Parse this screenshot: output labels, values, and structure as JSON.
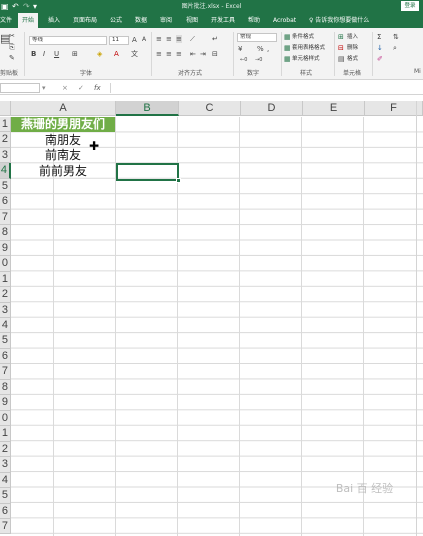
{
  "titlebar": {
    "title": "图片批注.xlsx - Excel",
    "login": "登录",
    "save_icon": "save-icon",
    "undo_icon": "undo-icon",
    "redo_icon": "redo-icon",
    "background": "#217346"
  },
  "tabs": [
    {
      "label": "文件"
    },
    {
      "label": "开始"
    },
    {
      "label": "插入"
    },
    {
      "label": "页面布局"
    },
    {
      "label": "公式"
    },
    {
      "label": "数据"
    },
    {
      "label": "审阅"
    },
    {
      "label": "视图"
    },
    {
      "label": "开发工具"
    },
    {
      "label": "帮助"
    },
    {
      "label": "Acrobat"
    }
  ],
  "tell_me": "♀ 告诉我你想要做什么",
  "ribbon": {
    "groups": {
      "clipboard": "剪贴板",
      "font": "字体",
      "alignment": "对齐方式",
      "number": "数字",
      "styles": "样式",
      "cells": "单元格",
      "mi": "Mi"
    },
    "font_name": "等线",
    "font_size": "11",
    "number_format": "常规",
    "style_items": [
      "条件格式",
      "套用表格格式",
      "单元格样式"
    ],
    "cell_items": [
      "插入",
      "删除",
      "格式"
    ]
  },
  "formula_bar": {
    "name_box": "",
    "cancel_icon": "×",
    "enter_icon": "✓",
    "fx": "fx",
    "value": ""
  },
  "grid": {
    "columns": [
      "A",
      "B",
      "C",
      "D",
      "E",
      "F"
    ],
    "rows": [
      "1",
      "2",
      "3",
      "4",
      "5",
      "6",
      "7",
      "8",
      "9",
      "0",
      "1",
      "2",
      "3",
      "4",
      "5",
      "6",
      "7",
      "8",
      "9",
      "0",
      "1",
      "2",
      "3",
      "4",
      "5",
      "6",
      "7"
    ],
    "cells": {
      "A1": "燕珊的男朋友们",
      "A2": "南朋友",
      "A3": "前南友",
      "A4": "前前男友"
    },
    "header_fill": "#70ad47",
    "selected_cell": "B4"
  },
  "watermark": "Bai 百 经验"
}
